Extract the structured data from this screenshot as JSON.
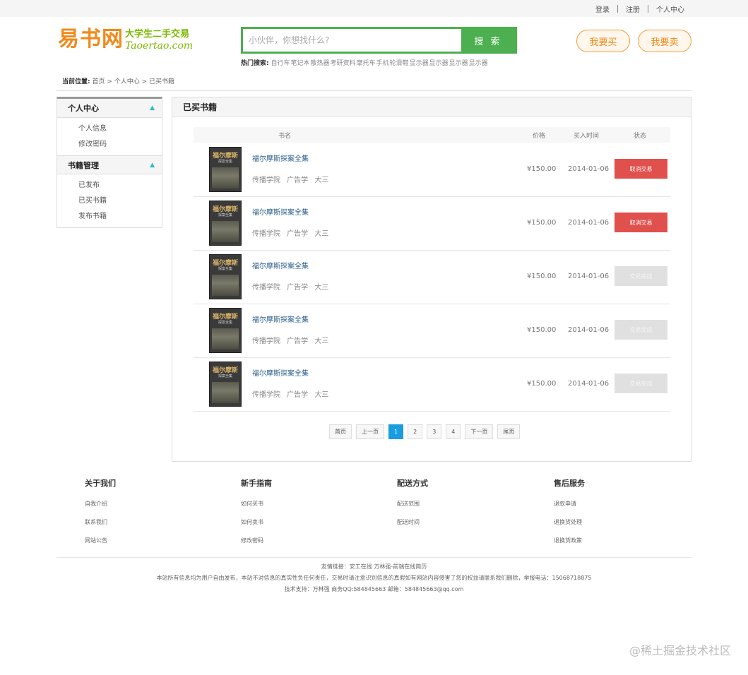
{
  "topbar": {
    "login": "登录",
    "register": "注册",
    "personal": "个人中心"
  },
  "logo": {
    "main": "易书网",
    "tagline": "大学生二手交易",
    "domain": "Taoertao.com"
  },
  "search": {
    "placeholder": "小伙伴，你想找什么?",
    "button": "搜 索"
  },
  "hot": {
    "label": "热门搜索:",
    "words": [
      "自行车",
      "笔记本",
      "散热器",
      "考研资料",
      "摩托车",
      "手机",
      "轮滑鞋",
      "显示器",
      "显示器",
      "显示器",
      "显示器"
    ]
  },
  "header_buttons": {
    "buy": "我要买",
    "sell": "我要卖"
  },
  "breadcrumb": {
    "label": "当前位置:",
    "path": "首页 > 个人中心 > 已买书籍"
  },
  "sidebar": {
    "group1": {
      "title": "个人中心",
      "items": [
        "个人信息",
        "修改密码"
      ]
    },
    "group2": {
      "title": "书籍管理",
      "items": [
        "已发布",
        "已买书籍",
        "发布书籍"
      ]
    }
  },
  "panel": {
    "title": "已买书籍",
    "columns": {
      "name": "书名",
      "price": "价格",
      "time": "买入时间",
      "status": "状态"
    },
    "cover": {
      "title": "福尔摩斯",
      "subtitle": "探案全集"
    },
    "rows": [
      {
        "title": "福尔摩斯探案全集",
        "meta": "传播学院 广告学 大三",
        "price": "¥150.00",
        "date": "2014-01-06",
        "action": "取消交易",
        "state": "cancel"
      },
      {
        "title": "福尔摩斯探案全集",
        "meta": "传播学院 广告学 大三",
        "price": "¥150.00",
        "date": "2014-01-06",
        "action": "取消交易",
        "state": "cancel"
      },
      {
        "title": "福尔摩斯探案全集",
        "meta": "传播学院 广告学 大三",
        "price": "¥150.00",
        "date": "2014-01-06",
        "action": "交易完成",
        "state": "done"
      },
      {
        "title": "福尔摩斯探案全集",
        "meta": "传播学院 广告学 大三",
        "price": "¥150.00",
        "date": "2014-01-06",
        "action": "交易完成",
        "state": "done"
      },
      {
        "title": "福尔摩斯探案全集",
        "meta": "传播学院 广告学 大三",
        "price": "¥150.00",
        "date": "2014-01-06",
        "action": "交易完成",
        "state": "done"
      }
    ],
    "pager": {
      "first": "首页",
      "prev": "上一页",
      "pages": [
        "1",
        "2",
        "3",
        "4"
      ],
      "current": "1",
      "next": "下一页",
      "last": "尾页"
    }
  },
  "footer": {
    "cols": [
      {
        "title": "关于我们",
        "items": [
          "自我介绍",
          "联系我们",
          "网站公告"
        ]
      },
      {
        "title": "新手指南",
        "items": [
          "如何买书",
          "如何卖书",
          "修改密码"
        ]
      },
      {
        "title": "配送方式",
        "items": [
          "配送范围",
          "配送时间"
        ]
      },
      {
        "title": "售后服务",
        "items": [
          "退款申请",
          "退换货处理",
          "退换货政策"
        ]
      }
    ],
    "links": "友情链接：安工在线 万林强-前端在线简历",
    "notice": "本站所有信息均为用户自由发布，本站不对信息的真实性负任何责任，交易时请注意识别信息的真假如有网站内容侵害了您的权益请联系我们删除，举报电话：15068718875",
    "support": "技术支持：万林强  商务QQ:584845663  邮箱：584845663@qq.com"
  },
  "watermark": "@稀土掘金技术社区"
}
